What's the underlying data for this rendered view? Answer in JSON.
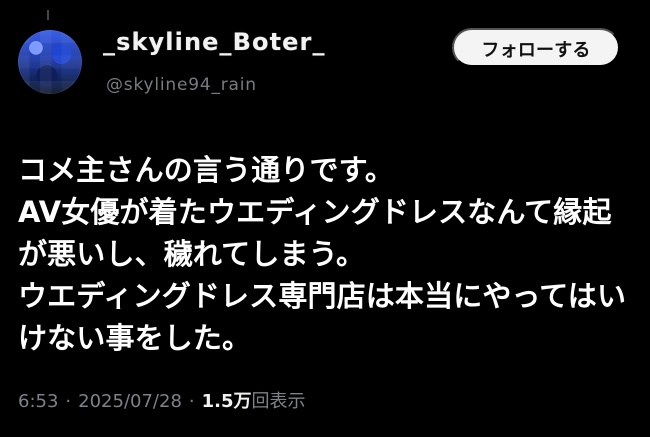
{
  "header": {
    "display_name": "_skyline_Boter_",
    "handle": "@skyline94_rain",
    "follow_label": "フォローする"
  },
  "tweet": {
    "text": "コメ主さんの言う通りです。AV女優が着たウエディングドレスなんて縁起が悪いし、穢れてしまう。ウエディングドレス専門店は本当にやってはいけない事をした。"
  },
  "meta": {
    "time": "6:53",
    "date": "2025/07/28",
    "views_count": "1.5万",
    "views_label": "回表示"
  }
}
